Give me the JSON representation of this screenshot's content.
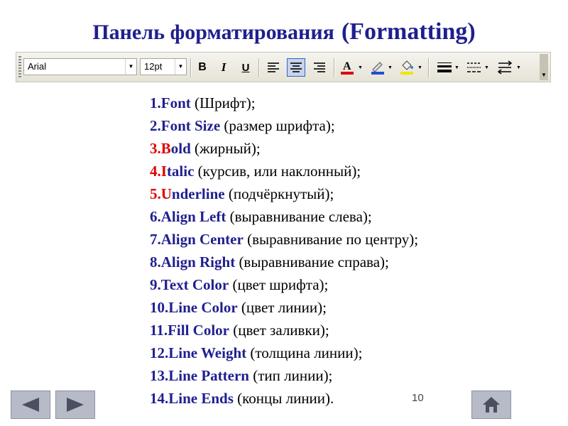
{
  "slide": {
    "title_ru": "Панель форматирования",
    "title_en": "(Formatting)",
    "page_number": "10"
  },
  "toolbar": {
    "font_name": "Arial",
    "font_size": "12pt",
    "bold_label": "B",
    "italic_label": "I",
    "underline_label": "U",
    "text_color": "#e00000",
    "line_color": "#1f4fd8",
    "fill_color": "#f2e600"
  },
  "items": [
    {
      "num": "1.",
      "first": "",
      "rest": "Font",
      "desc": " (Шрифт);"
    },
    {
      "num": "2.",
      "first": "",
      "rest": "Font Size",
      "desc": " (размер шрифта);"
    },
    {
      "num": "3.",
      "first": "B",
      "rest": "old",
      "desc": " (жирный);"
    },
    {
      "num": "4.",
      "first": "I",
      "rest": "talic",
      "desc": " (курсив, или наклонный);"
    },
    {
      "num": "5.",
      "first": "U",
      "rest": "nderline",
      "desc": " (подчёркнутый);"
    },
    {
      "num": "6.",
      "first": "",
      "rest": "Align Left",
      "desc": " (выравнивание слева);"
    },
    {
      "num": "7.",
      "first": "",
      "rest": "Align Center",
      "desc": " (выравнивание по центру);"
    },
    {
      "num": "8.",
      "first": "",
      "rest": "Align Right",
      "desc": " (выравнивание справа);"
    },
    {
      "num": "9.",
      "first": "",
      "rest": "Text Color",
      "desc": " (цвет шрифта);"
    },
    {
      "num": "10.",
      "first": "",
      "rest": "Line Color",
      "desc": " (цвет линии);"
    },
    {
      "num": "11.",
      "first": "",
      "rest": "Fill Color",
      "desc": " (цвет заливки);"
    },
    {
      "num": "12.",
      "first": "",
      "rest": "Line Weight",
      "desc": " (толщина линии);"
    },
    {
      "num": "13.",
      "first": "",
      "rest": "Line Pattern",
      "desc": " (тип линии);"
    },
    {
      "num": "14.",
      "first": "",
      "rest": "Line Ends",
      "desc": " (концы линии)."
    }
  ],
  "icons": {
    "prev": "back-arrow-icon",
    "next": "forward-arrow-icon",
    "home": "home-icon"
  }
}
